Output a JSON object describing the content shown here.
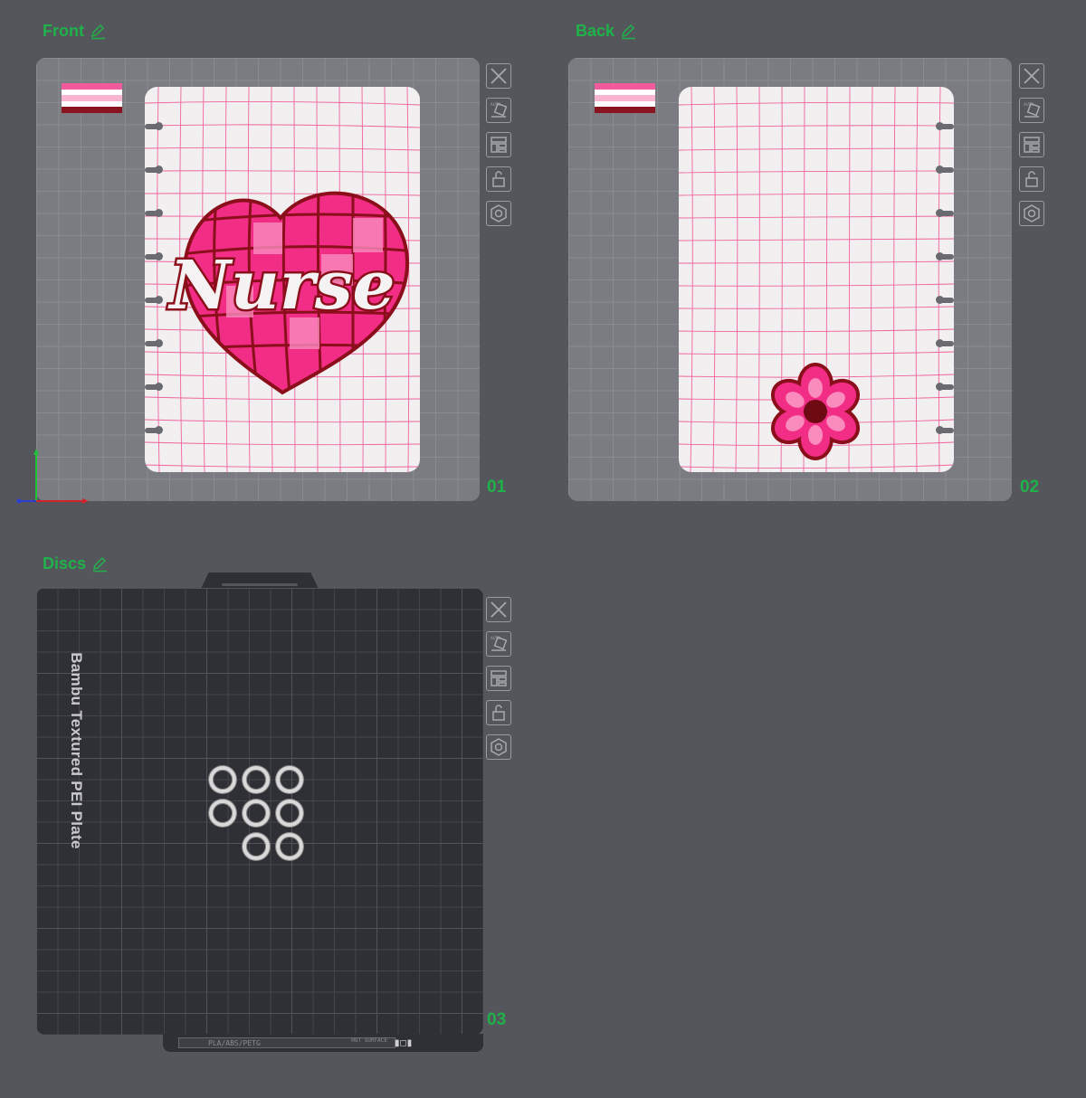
{
  "plates": [
    {
      "title": "Front",
      "number": "01"
    },
    {
      "title": "Back",
      "number": "02"
    },
    {
      "title": "Discs",
      "number": "03"
    }
  ],
  "front_design": {
    "text": "Nurse"
  },
  "dark_plate": {
    "label": "Bambu Textured PEI Plate",
    "bottom_text": "PLA/ABS/PETG",
    "hot_text": "HOT SURFACE"
  },
  "toolbar_icons": [
    "close-icon",
    "auto-orient-icon",
    "arrange-icon",
    "lock-icon",
    "settings-icon"
  ],
  "colors": {
    "accent": "#1fb24a",
    "grid_pink": "#f04b8f",
    "heart_pink": "#f22d86",
    "heart_dark": "#8b0f1a"
  },
  "swatch_colors": [
    "#f25a9b",
    "#ffffff",
    "#f9b5cf",
    "#ffffff",
    "#8a1520"
  ]
}
